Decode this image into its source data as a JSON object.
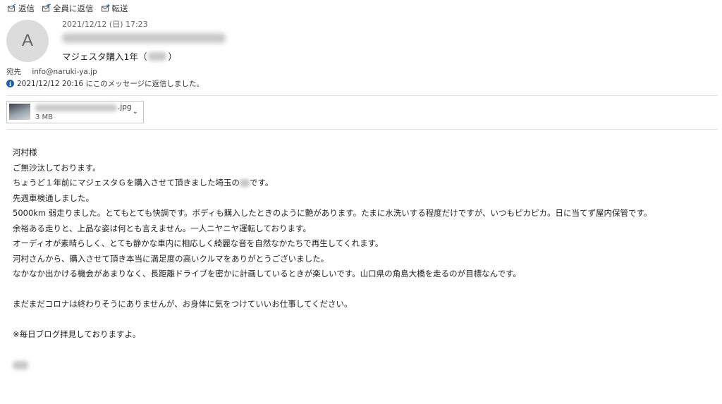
{
  "toolbar": {
    "reply": {
      "label": "返信",
      "icon": "reply-icon"
    },
    "reply_all": {
      "label": "全員に返信",
      "icon": "reply-all-icon"
    },
    "forward": {
      "label": "転送",
      "icon": "forward-icon"
    }
  },
  "header": {
    "avatar_initial": "A",
    "date": "2021/12/12 (日) 17:23",
    "subject_prefix": "マジェスタ購入1年（",
    "subject_suffix": "）",
    "to_label": "宛先",
    "to_address": "info@naruki-ya.jp",
    "info_text": "2021/12/12 20:16 にこのメッセージに返信しました。"
  },
  "attachment": {
    "ext": ".jpg",
    "size": "3 MB"
  },
  "message": {
    "greeting": "河村様",
    "line1": "ご無沙汰しております。",
    "line2a": "ちょうど１年前にマジェスタＧを購入させて頂きました埼玉の",
    "line2b": "です。",
    "line3": "先週車検通しました。",
    "line4": "5000km 弱走りました。とてもとても快調です。ボディも購入したときのように艶があります。たまに水洗いする程度だけですが、いつもピカピカ。日に当てず屋内保管です。",
    "line5": "余裕ある走りと、上品な姿は何とも言えません。一人ニヤニヤ運転しております。",
    "line6": "オーディオが素晴らしく、とても静かな車内に相応しく綺麗な音を自然なかたちで再生してくれます。",
    "line7": "河村さんから、購入させて頂き本当に満足度の高いクルマをありがとうございました。",
    "line8": "なかなか出かける機会があまりなく、長距離ドライブを密かに計画しているときが楽しいです。山口県の角島大橋を走るのが目標なんです。",
    "line9": "まだまだコロナは終わりそうにありませんが、お身体に気をつけていいお仕事してください。",
    "line10": "※毎日ブログ拝見しておりますよ。"
  }
}
